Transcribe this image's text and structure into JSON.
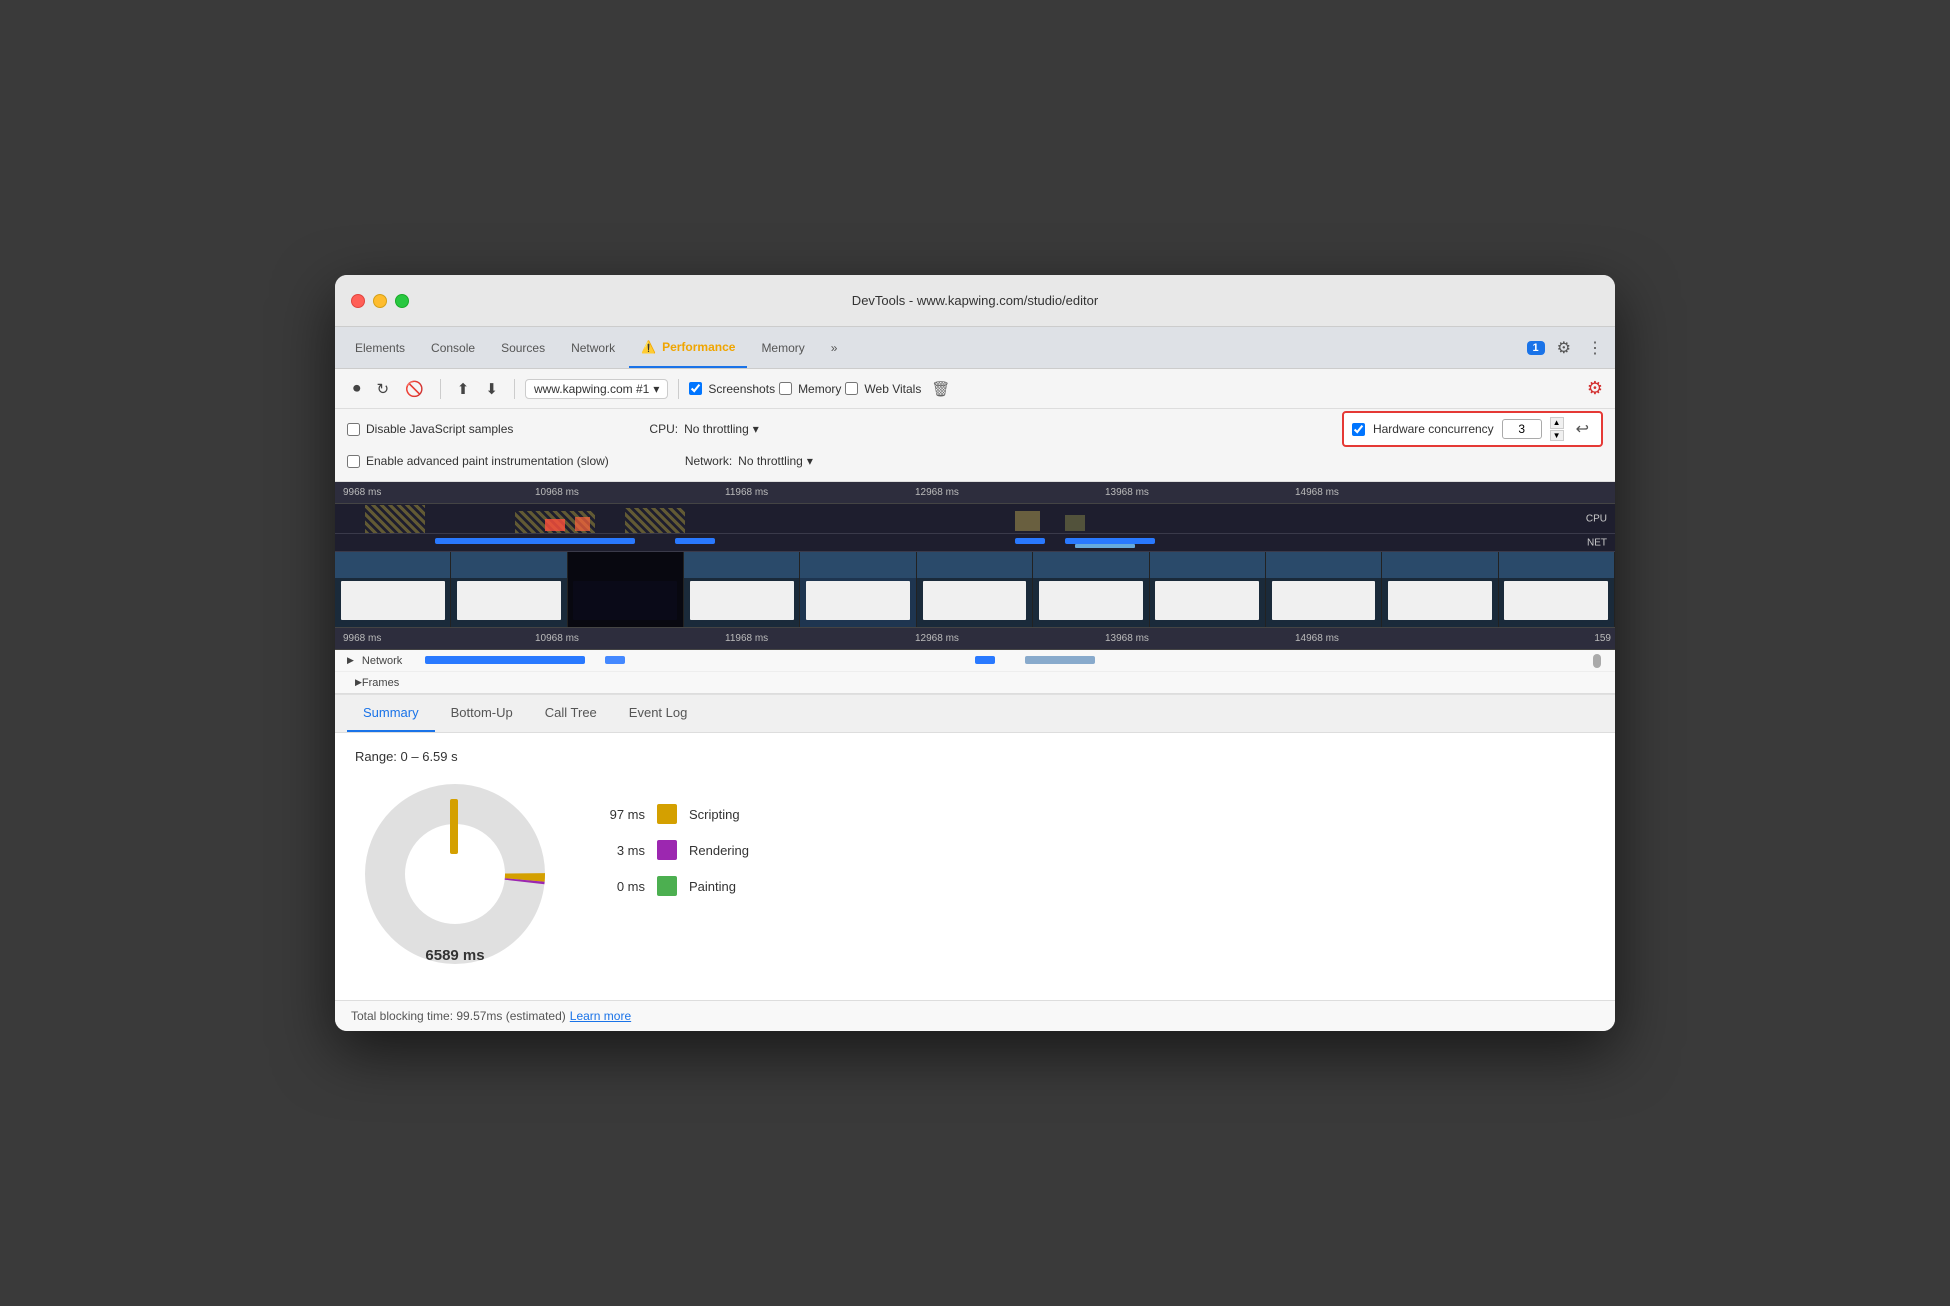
{
  "window": {
    "title": "DevTools - www.kapwing.com/studio/editor"
  },
  "tabs": {
    "items": [
      {
        "label": "Elements",
        "active": false
      },
      {
        "label": "Console",
        "active": false
      },
      {
        "label": "Sources",
        "active": false
      },
      {
        "label": "Network",
        "active": false
      },
      {
        "label": "Performance",
        "active": true,
        "hasWarning": true
      },
      {
        "label": "Memory",
        "active": false
      },
      {
        "label": "More tabs",
        "active": false
      }
    ],
    "badge": "1",
    "settings_label": "⚙",
    "more_label": "⋮"
  },
  "toolbar": {
    "record_label": "●",
    "reload_label": "↻",
    "clear_label": "🚫",
    "upload_label": "↑",
    "download_label": "↓",
    "target": "www.kapwing.com #1",
    "screenshots_label": "Screenshots",
    "memory_label": "Memory",
    "web_vitals_label": "Web Vitals",
    "delete_label": "🗑",
    "settings_label": "⚙"
  },
  "options": {
    "disable_js_samples": "Disable JavaScript samples",
    "enable_advanced_paint": "Enable advanced paint instrumentation (slow)",
    "cpu_label": "CPU:",
    "cpu_throttle": "No throttling",
    "network_label": "Network:",
    "network_throttle": "No throttling",
    "hw_concurrency_label": "Hardware concurrency",
    "hw_concurrency_value": "3",
    "hw_concurrency_checked": true
  },
  "timeline": {
    "time_markers_top": [
      "9968 ms",
      "10968 ms",
      "11968 ms",
      "12968 ms",
      "13968 ms",
      "14968 ms"
    ],
    "time_markers_bottom": [
      "9968 ms",
      "10968 ms",
      "11968 ms",
      "12968 ms",
      "13968 ms",
      "14968 ms",
      "159"
    ],
    "cpu_label": "CPU",
    "net_label": "NET"
  },
  "tracks": {
    "network_label": "Network",
    "frames_label": "Frames"
  },
  "bottom_tabs": {
    "items": [
      {
        "label": "Summary",
        "active": true
      },
      {
        "label": "Bottom-Up",
        "active": false
      },
      {
        "label": "Call Tree",
        "active": false
      },
      {
        "label": "Event Log",
        "active": false
      }
    ]
  },
  "summary": {
    "range_label": "Range: 0 – 6.59 s",
    "center_label": "6589 ms",
    "legend": [
      {
        "value": "97 ms",
        "color": "#d4a000",
        "name": "Scripting"
      },
      {
        "value": "3 ms",
        "color": "#9c27b0",
        "name": "Rendering"
      },
      {
        "value": "0 ms",
        "color": "#4caf50",
        "name": "Painting"
      }
    ]
  },
  "status_bar": {
    "text": "Total blocking time: 99.57ms (estimated)",
    "learn_more": "Learn more"
  }
}
